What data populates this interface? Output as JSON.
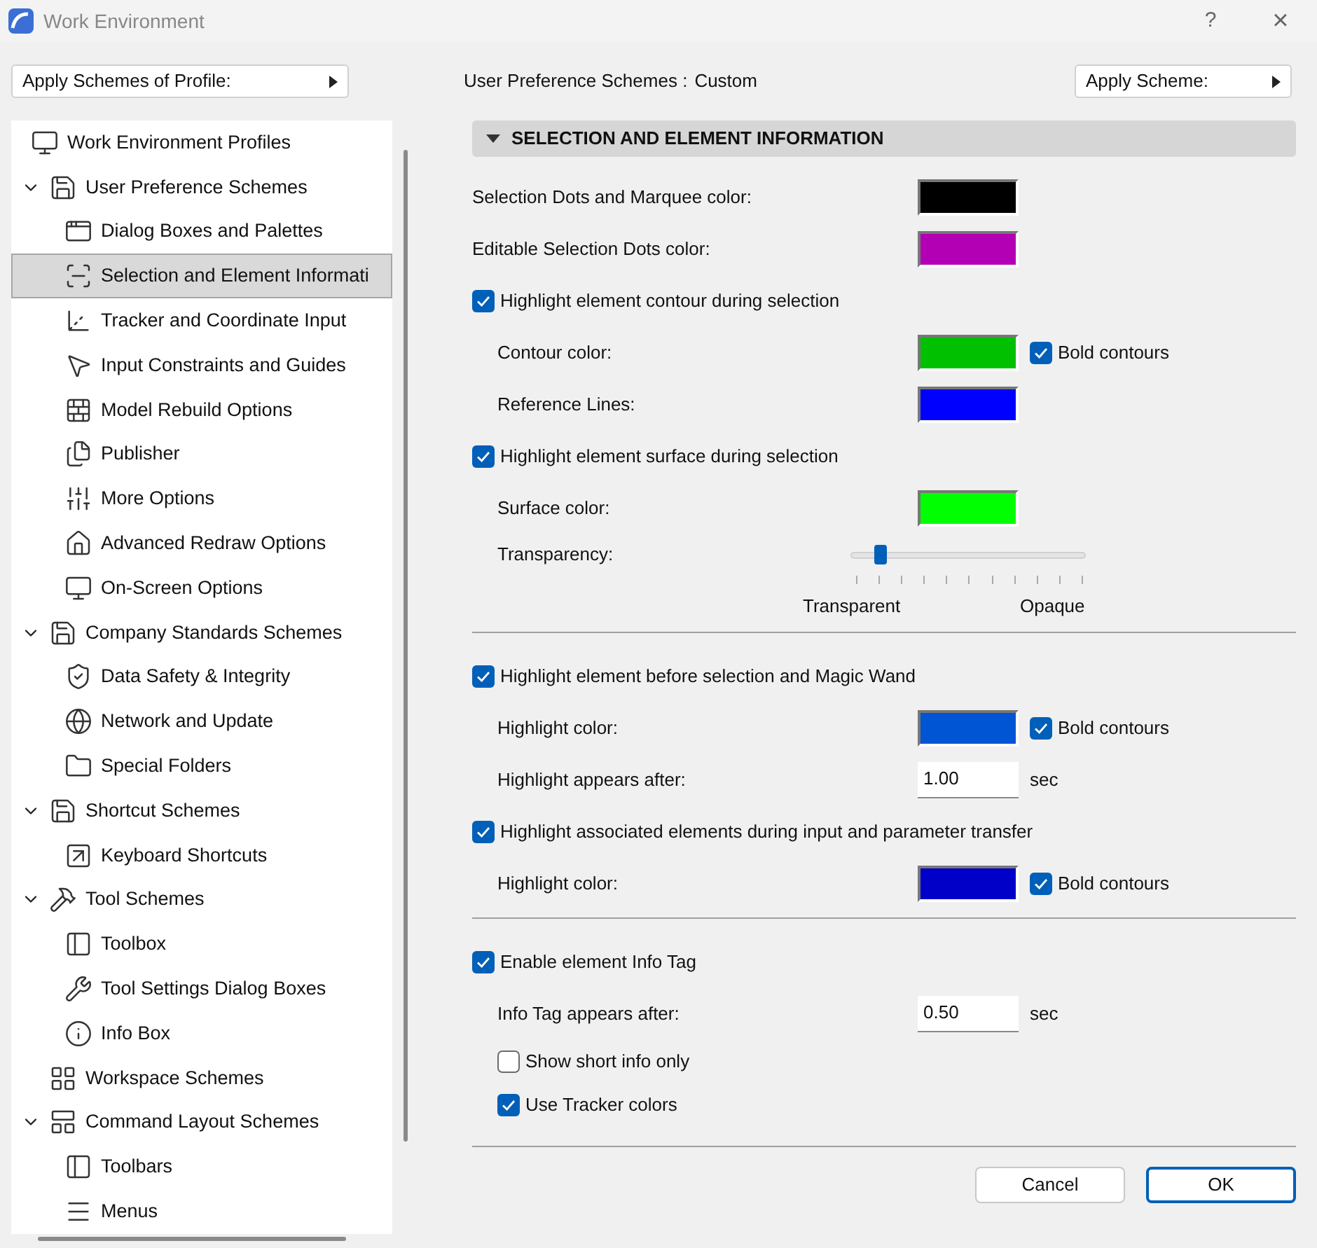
{
  "window": {
    "title": "Work Environment",
    "help": "?",
    "close": "×"
  },
  "profile_button": {
    "label": "Apply Schemes of Profile:"
  },
  "scheme_info": {
    "label": "User Preference Schemes :",
    "value": "Custom"
  },
  "scheme_button": {
    "label": "Apply Scheme:"
  },
  "tree": [
    {
      "label": "Work Environment Profiles",
      "kind": "profiles",
      "selected": false
    },
    {
      "label": "User Preference Schemes",
      "kind": "scheme",
      "selected": false,
      "expanded": true,
      "children": [
        {
          "label": "Dialog Boxes and Palettes",
          "selected": false
        },
        {
          "label": "Selection and Element Informati",
          "selected": true
        },
        {
          "label": "Tracker and Coordinate Input",
          "selected": false
        },
        {
          "label": "Input Constraints and Guides",
          "selected": false
        },
        {
          "label": "Model Rebuild Options",
          "selected": false
        },
        {
          "label": "Publisher",
          "selected": false
        },
        {
          "label": "More Options",
          "selected": false
        },
        {
          "label": "Advanced Redraw Options",
          "selected": false
        },
        {
          "label": "On-Screen Options",
          "selected": false
        }
      ]
    },
    {
      "label": "Company Standards Schemes",
      "kind": "scheme",
      "selected": false,
      "expanded": true,
      "children": [
        {
          "label": "Data Safety & Integrity",
          "selected": false
        },
        {
          "label": "Network and Update",
          "selected": false
        },
        {
          "label": "Special Folders",
          "selected": false
        }
      ]
    },
    {
      "label": "Shortcut Schemes",
      "kind": "scheme",
      "selected": false,
      "expanded": true,
      "children": [
        {
          "label": "Keyboard Shortcuts",
          "selected": false
        }
      ]
    },
    {
      "label": "Tool Schemes",
      "kind": "scheme",
      "selected": false,
      "expanded": true,
      "children": [
        {
          "label": "Toolbox",
          "selected": false
        },
        {
          "label": "Tool Settings Dialog Boxes",
          "selected": false
        },
        {
          "label": "Info Box",
          "selected": false
        }
      ]
    },
    {
      "label": "Workspace Schemes",
      "kind": "scheme",
      "selected": false
    },
    {
      "label": "Command Layout Schemes",
      "kind": "scheme",
      "selected": false,
      "expanded": true,
      "children": [
        {
          "label": "Toolbars",
          "selected": false
        },
        {
          "label": "Menus",
          "selected": false
        }
      ]
    }
  ],
  "panel": {
    "title": "SELECTION AND ELEMENT INFORMATION",
    "expanded": true,
    "sections": [
      {
        "rows": [
          {
            "kind": "color",
            "label": "Selection Dots and Marquee color:",
            "color": "#000000"
          },
          {
            "kind": "color",
            "label": "Editable Selection Dots color:",
            "color": "#b400b4"
          },
          {
            "kind": "checkbox",
            "label": "Highlight element contour during selection",
            "checked": true,
            "children": [
              {
                "kind": "color",
                "label": "Contour color:",
                "color": "#00c000",
                "bold": {
                  "label": "Bold contours",
                  "checked": true
                }
              },
              {
                "kind": "color",
                "label": "Reference Lines:",
                "color": "#0000ff"
              }
            ]
          },
          {
            "kind": "checkbox",
            "label": "Highlight element surface during selection",
            "checked": true,
            "children": [
              {
                "kind": "color",
                "label": "Surface color:",
                "color": "#00ff00"
              },
              {
                "kind": "slider",
                "label": "Transparency:",
                "level": 0.12,
                "min_label": "Transparent",
                "max_label": "Opaque"
              }
            ]
          }
        ]
      },
      {
        "rows": [
          {
            "kind": "checkbox",
            "label": "Highlight element before selection and Magic Wand",
            "checked": true,
            "children": [
              {
                "kind": "color",
                "label": "Highlight color:",
                "color": "#0055d4",
                "bold": {
                  "label": "Bold contours",
                  "checked": true
                }
              },
              {
                "kind": "field",
                "label": "Highlight appears after:",
                "value": "1.00",
                "unit": "sec"
              }
            ]
          },
          {
            "kind": "checkbox",
            "label": "Highlight associated elements during input and parameter transfer",
            "checked": true,
            "children": [
              {
                "kind": "color",
                "label": "Highlight color:",
                "color": "#0000c8",
                "bold": {
                  "label": "Bold contours",
                  "checked": true
                }
              }
            ]
          }
        ]
      },
      {
        "rows": [
          {
            "kind": "checkbox",
            "label": "Enable element Info Tag",
            "checked": true,
            "children": [
              {
                "kind": "field",
                "label": "Info Tag appears after:",
                "value": "0.50",
                "unit": "sec"
              },
              {
                "kind": "checkbox",
                "label": "Show short info only",
                "checked": false
              },
              {
                "kind": "checkbox",
                "label": "Use Tracker colors",
                "checked": true
              }
            ]
          }
        ]
      }
    ]
  },
  "buttons": [
    {
      "label": "Cancel",
      "kind": "secondary"
    },
    {
      "label": "OK",
      "kind": "primary"
    }
  ]
}
